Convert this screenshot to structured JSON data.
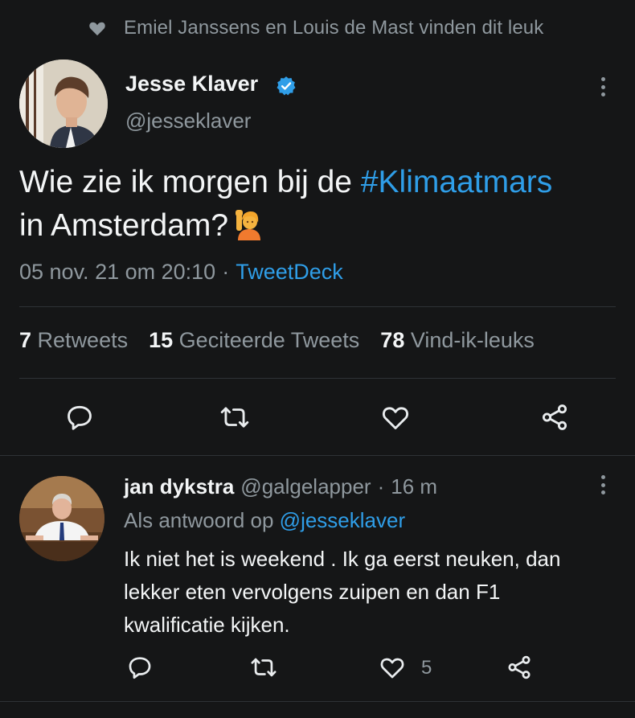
{
  "social_context": {
    "liked_by_text": "Emiel Janssens en Louis de Mast vinden dit leuk",
    "icon": "heart-icon"
  },
  "tweet": {
    "author_name": "Jesse Klaver",
    "author_handle": "@jesseklaver",
    "verified_icon": "verified-badge-icon",
    "text_part1": "Wie zie ik morgen bij de ",
    "hashtag": "#Klimaatmars",
    "text_part2": "in Amsterdam?",
    "emoji": "person-raising-hand-emoji",
    "timestamp": "05 nov. 21 om 20:10",
    "separator": "·",
    "source": "TweetDeck",
    "stats": [
      {
        "count": "7",
        "label": "Retweets"
      },
      {
        "count": "15",
        "label": "Geciteerde Tweets"
      },
      {
        "count": "78",
        "label": "Vind-ik-leuks"
      }
    ],
    "actions": [
      "reply-icon",
      "retweet-icon",
      "like-icon",
      "share-icon"
    ]
  },
  "reply": {
    "author_name": "jan dykstra",
    "author_handle": "@galgelapper",
    "separator": "·",
    "time": "16 m",
    "replying_to_prefix": "Als antwoord op ",
    "replying_to_handle": "@jesseklaver",
    "text": "Ik niet het is weekend . Ik ga eerst neuken, dan lekker eten vervolgens zuipen en dan F1 kwalificatie kijken.",
    "like_count": "5",
    "actions": [
      "reply-icon",
      "retweet-icon",
      "like-icon",
      "share-icon"
    ]
  },
  "colors": {
    "background": "#151617",
    "accent": "#2f9ee8",
    "secondary_text": "#8f989e",
    "primary_text": "#f3f5f6"
  }
}
